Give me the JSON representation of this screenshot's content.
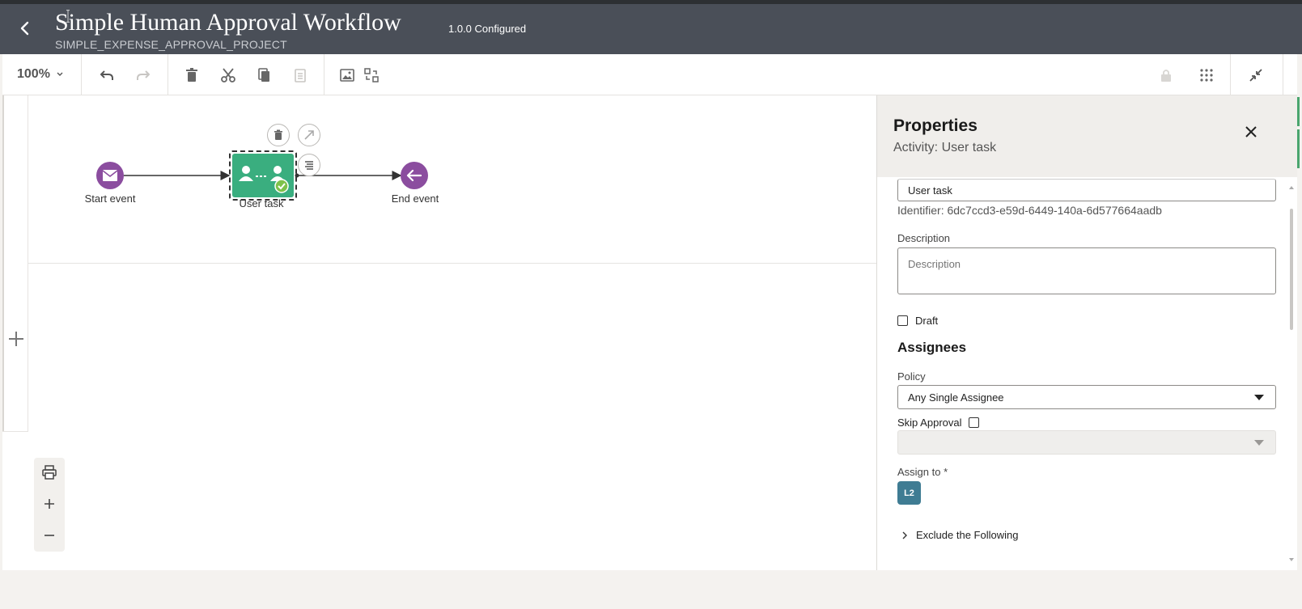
{
  "header": {
    "title": "Simple Human Approval Workflow",
    "version": "1.0.0 Configured",
    "project": "SIMPLE_EXPENSE_APPROVAL_PROJECT"
  },
  "toolbar": {
    "zoom_level": "100%"
  },
  "diagram": {
    "start_label": "Start event",
    "task_label": "User task",
    "end_label": "End event"
  },
  "properties": {
    "title": "Properties",
    "subtitle": "Activity: User task",
    "name_value": "User task",
    "identifier": "Identifier: 6dc7ccd3-e59d-6449-140a-6d577664aadb",
    "description_label": "Description",
    "description_placeholder": "Description",
    "draft_label": "Draft",
    "assignees_heading": "Assignees",
    "policy_label": "Policy",
    "policy_value": "Any Single Assignee",
    "skip_approval_label": "Skip Approval",
    "skip_approval_value": "",
    "assign_to_label": "Assign to *",
    "assignee_badge": "L2",
    "exclude_label": "Exclude the Following"
  },
  "colors": {
    "header_bg": "#4a4f58",
    "event_purple": "#8b4d9f",
    "task_green": "#3aae7f",
    "avatar_teal": "#3f7c93"
  }
}
